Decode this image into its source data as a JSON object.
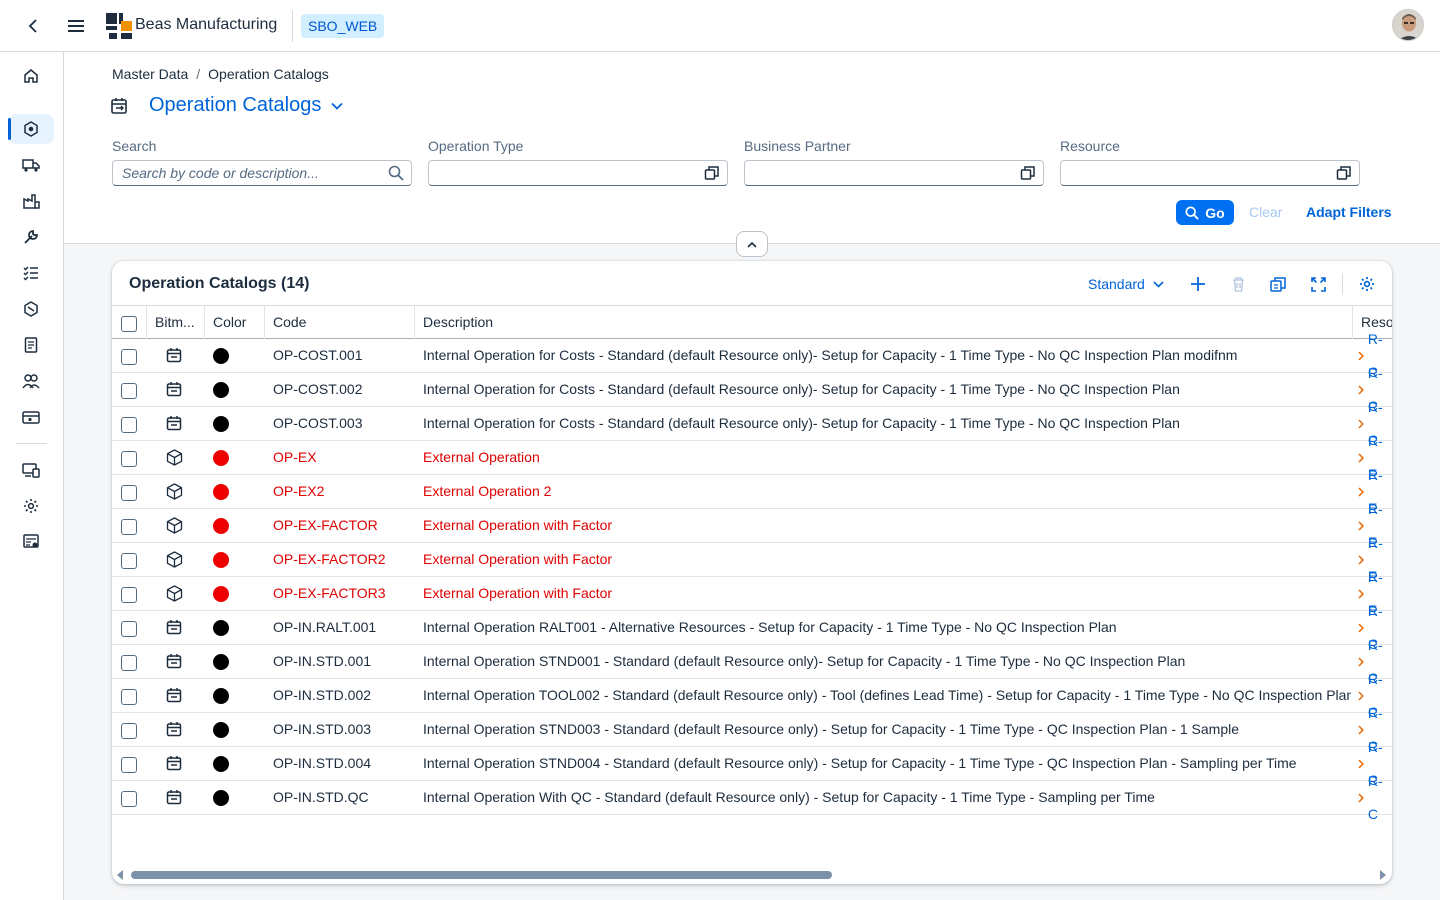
{
  "shell": {
    "app_name": "Beas Manufacturing",
    "system": "SBO_WEB"
  },
  "breadcrumb": [
    "Master Data",
    "Operation Catalogs"
  ],
  "page_title": "Operation Catalogs",
  "filters": {
    "search_label": "Search",
    "search_placeholder": "Search by code or description...",
    "operation_type_label": "Operation Type",
    "business_partner_label": "Business Partner",
    "resource_label": "Resource",
    "go": "Go",
    "clear": "Clear",
    "adapt": "Adapt Filters"
  },
  "table": {
    "title": "Operation Catalogs (14)",
    "variant": "Standard",
    "columns": [
      "Bitm...",
      "Color",
      "Code",
      "Description",
      "Reso"
    ],
    "rows": [
      {
        "icon": "calendar",
        "color": "black",
        "code": "OP-COST.001",
        "desc": "Internal Operation for Costs - Standard (default Resource only)- Setup for Capacity - 1 Time Type - No QC Inspection Plan modifnm",
        "res": "R-C"
      },
      {
        "icon": "calendar",
        "color": "black",
        "code": "OP-COST.002",
        "desc": "Internal Operation for Costs - Standard (default Resource only)- Setup for Capacity - 1 Time Type - No QC Inspection Plan",
        "res": "R-C"
      },
      {
        "icon": "calendar",
        "color": "black",
        "code": "OP-COST.003",
        "desc": "Internal Operation for Costs - Standard (default Resource only)- Setup for Capacity - 1 Time Type - No QC Inspection Plan",
        "res": "R-C"
      },
      {
        "icon": "box",
        "color": "red",
        "code": "OP-EX",
        "desc": "External Operation",
        "res": "R-E"
      },
      {
        "icon": "box",
        "color": "red",
        "code": "OP-EX2",
        "desc": "External Operation 2",
        "res": "R-E"
      },
      {
        "icon": "box",
        "color": "red",
        "code": "OP-EX-FACTOR",
        "desc": "External Operation with Factor",
        "res": "R-E"
      },
      {
        "icon": "box",
        "color": "red",
        "code": "OP-EX-FACTOR2",
        "desc": "External Operation with Factor",
        "res": "R-E"
      },
      {
        "icon": "box",
        "color": "red",
        "code": "OP-EX-FACTOR3",
        "desc": "External Operation with Factor",
        "res": "R-E"
      },
      {
        "icon": "calendar",
        "color": "black",
        "code": "OP-IN.RALT.001",
        "desc": "Internal Operation RALT001 - Alternative Resources - Setup for Capacity - 1 Time Type - No QC Inspection Plan",
        "res": "R-C"
      },
      {
        "icon": "calendar",
        "color": "black",
        "code": "OP-IN.STD.001",
        "desc": "Internal Operation STND001 - Standard (default Resource only)- Setup for Capacity - 1 Time Type - No QC Inspection Plan",
        "res": "R-C"
      },
      {
        "icon": "calendar",
        "color": "black",
        "code": "OP-IN.STD.002",
        "desc": "Internal Operation TOOL002 - Standard (default Resource only) - Tool (defines Lead Time) - Setup for Capacity - 1 Time Type - No QC Inspection Plan",
        "res": "R-C"
      },
      {
        "icon": "calendar",
        "color": "black",
        "code": "OP-IN.STD.003",
        "desc": "Internal Operation STND003 - Standard (default Resource only) - Setup for Capacity - 1 Time Type - QC Inspection Plan - 1 Sample",
        "res": "R-C"
      },
      {
        "icon": "calendar",
        "color": "black",
        "code": "OP-IN.STD.004",
        "desc": "Internal Operation STND004 - Standard (default Resource only) - Setup for Capacity - 1 Time Type - QC Inspection Plan - Sampling per Time",
        "res": "R-C"
      },
      {
        "icon": "calendar",
        "color": "black",
        "code": "OP-IN.STD.QC",
        "desc": "Internal Operation With QC - Standard (default Resource only) - Setup for Capacity - 1 Time Type - Sampling per Time",
        "res": "R-C"
      }
    ]
  },
  "colors": {
    "accent": "#0064d9",
    "button": "#0070f2",
    "external_text": "#e00000",
    "dot_black": "#000000",
    "dot_red": "#ee0000"
  },
  "icons": {
    "nav": [
      "home-icon",
      "production-icon",
      "shipping-icon",
      "factory-icon",
      "tools-icon",
      "task-list-icon",
      "product-icon",
      "document-icon",
      "people-icon",
      "finance-icon",
      "devices-icon",
      "settings-icon",
      "report-icon"
    ]
  }
}
